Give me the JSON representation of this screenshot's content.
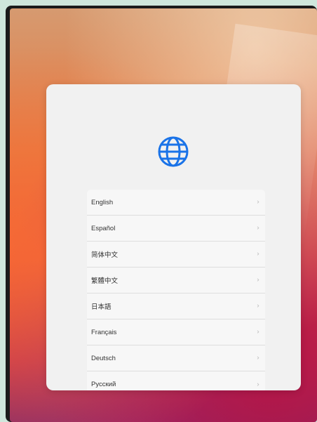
{
  "icons": {
    "globe": "globe-icon",
    "chevron": "chevron-right-icon"
  },
  "colors": {
    "accent": "#1a73e8",
    "dialog_background": "#f1f1f1"
  },
  "languages": [
    {
      "label": "English"
    },
    {
      "label": "Español"
    },
    {
      "label": "简体中文"
    },
    {
      "label": "繁體中文"
    },
    {
      "label": "日本語"
    },
    {
      "label": "Français"
    },
    {
      "label": "Deutsch"
    },
    {
      "label": "Русский"
    }
  ]
}
